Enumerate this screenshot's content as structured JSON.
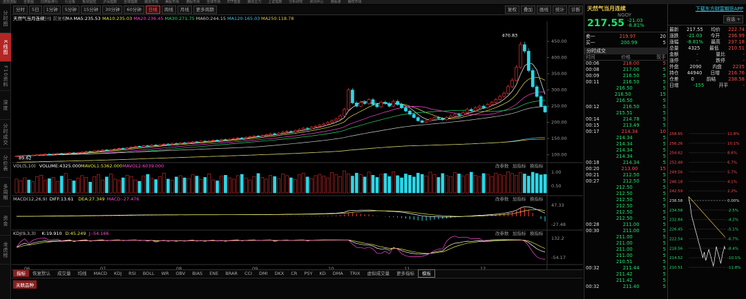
{
  "top_menu": [
    "选自选股",
    "全景图",
    "同类股排行",
    "行业板",
    "板块监控",
    "沪深指数",
    "全球指数",
    "期货市场",
    "美股市场",
    "港股市场",
    "全球市场",
    "ETF基金",
    "期货主力",
    "上证指数",
    "分析研究",
    "资讯中心",
    "港股通",
    "期权市场"
  ],
  "left_nav": [
    {
      "label": "分时图",
      "active": false
    },
    {
      "label": "K线图",
      "active": true
    },
    {
      "label": "F10资料",
      "active": false
    },
    {
      "label": "深度",
      "active": false
    },
    {
      "label": "分时成交",
      "active": false
    },
    {
      "label": "分价表",
      "active": false
    },
    {
      "label": "多周期",
      "active": false
    },
    {
      "label": "资金",
      "active": false
    },
    {
      "label": "龙虎榜",
      "active": false
    }
  ],
  "toolbar": {
    "periods": [
      "分时",
      "5日",
      "1分钟",
      "5分钟",
      "15分钟",
      "30分钟",
      "60分钟",
      "日线",
      "周线",
      "月线",
      "更多周期"
    ],
    "active_period": "日线",
    "right_buttons": [
      "复权",
      "叠加",
      "画线",
      "统计",
      "诊断"
    ]
  },
  "chart": {
    "title": "天然气当月连续",
    "subtitle": "(日线 前复权)",
    "ma_legend": [
      {
        "t": "MA",
        "c": "#cccccc"
      },
      {
        "t": "MA5:235.53",
        "c": "#ffffff"
      },
      {
        "t": "MA10:235.03",
        "c": "#e8e84a"
      },
      {
        "t": "MA20:236.45",
        "c": "#ff4ad8"
      },
      {
        "t": "MA30:271.75",
        "c": "#22e06a"
      },
      {
        "t": "MA60:244.15",
        "c": "#cccccc"
      },
      {
        "t": "MA120:165.03",
        "c": "#3ec8e8"
      },
      {
        "t": "MA250:118.78",
        "c": "#e8c84a"
      }
    ],
    "price_ticks": [
      "450.00",
      "400.00",
      "350.00",
      "300.00",
      "250.00",
      "200.00",
      "150.00",
      "100.00"
    ],
    "high_label": "470.83",
    "low_label": "89.62",
    "x_ticks": [
      "06",
      "07",
      "08",
      "09",
      "10",
      "11",
      "12"
    ],
    "chart_data": {
      "type": "candlestick",
      "ylim": [
        80,
        480
      ],
      "high": 470.83,
      "low": 89.62,
      "close": [
        96,
        97,
        98,
        97,
        99,
        100,
        101,
        102,
        101,
        103,
        104,
        103,
        105,
        106,
        105,
        107,
        108,
        110,
        109,
        112,
        113,
        115,
        114,
        116,
        118,
        120,
        119,
        122,
        124,
        126,
        125,
        128,
        127,
        130,
        128,
        131,
        133,
        132,
        135,
        134,
        137,
        136,
        138,
        140,
        139,
        142,
        141,
        143,
        145,
        144,
        147,
        146,
        148,
        150,
        152,
        151,
        154,
        156,
        158,
        157,
        160,
        162,
        165,
        163,
        167,
        170,
        172,
        171,
        175,
        178,
        182,
        180,
        185,
        188,
        192,
        195,
        200,
        205,
        210,
        220,
        240,
        300,
        260,
        250,
        262,
        258,
        270,
        255,
        248,
        262,
        258,
        250,
        265,
        255,
        245,
        235,
        225,
        215,
        205,
        200,
        205,
        210,
        215,
        212,
        208,
        215,
        220,
        225,
        222,
        230,
        240,
        236,
        245,
        250,
        245,
        255,
        262,
        270,
        280,
        290,
        310,
        330,
        370,
        440,
        420,
        360,
        310,
        280,
        250,
        232
      ],
      "volume": [
        3.2,
        2.8,
        3.5,
        3.0,
        2.6,
        3.8,
        4.1,
        2.9,
        3.3,
        3.6,
        2.7,
        3.9,
        4.5,
        3.1,
        2.8,
        3.4,
        4.0,
        3.6,
        2.5,
        3.8,
        4.2,
        3.0,
        3.7,
        4.4,
        3.2,
        2.9,
        3.5,
        4.1,
        3.8,
        3.0,
        2.7,
        3.9,
        4.3,
        3.4,
        3.1,
        3.8,
        4.6,
        3.2,
        2.9,
        3.7,
        4.0,
        3.5,
        3.3,
        4.2,
        3.9,
        3.1,
        3.6,
        4.4,
        3.0,
        2.8,
        3.9,
        4.1,
        3.5,
        3.2,
        4.0,
        4.3,
        3.4,
        3.0,
        3.8,
        4.5,
        3.6,
        3.2,
        4.1,
        3.8,
        3.3,
        4.4,
        4.0,
        3.5,
        3.1,
        4.2,
        4.6,
        3.7,
        3.3,
        4.0,
        4.3,
        3.9,
        3.5,
        4.7,
        4.2,
        3.8,
        5.1,
        4.4,
        3.9,
        4.6,
        4.2,
        3.7,
        4.8,
        4.1,
        3.6,
        4.3,
        4.5,
        3.8,
        4.9,
        4.0,
        3.5,
        4.4,
        4.1,
        3.7,
        4.6,
        4.3,
        3.9,
        4.8,
        4.2,
        3.6,
        4.5,
        4.0,
        3.8,
        4.7,
        4.4,
        3.9,
        4.2,
        4.8,
        4.1,
        3.7,
        4.5,
        4.3,
        3.8,
        4.6,
        4.2,
        4.0,
        4.9,
        4.5,
        4.1,
        4.7,
        4.4,
        3.9,
        4.8,
        4.5,
        4.2,
        4.3
      ]
    }
  },
  "vol_legend": [
    {
      "t": "VOL(5,10)",
      "c": "#cccccc"
    },
    {
      "t": "VOLUME:4325.000",
      "c": "#ffffff"
    },
    {
      "t": "MAVOL1:5362.000",
      "c": "#e8e84a"
    },
    {
      "t": "MAVOL2:6039.000",
      "c": "#ff4ad8"
    }
  ],
  "vol_ticks": [
    "1.00",
    "0.50"
  ],
  "macd_legend": [
    {
      "t": "MACD(12,26,9)",
      "c": "#cccccc"
    },
    {
      "t": "DIFF:13.61",
      "c": "#ffffff"
    },
    {
      "t": "DEA:27.349",
      "c": "#e8e84a"
    },
    {
      "t": "MACD:-27.476",
      "c": "#ff4ad8"
    }
  ],
  "macd_ticks": [
    "47.33",
    "-27.48"
  ],
  "kdj_legend": [
    {
      "t": "KDJ(9,3,3)",
      "c": "#cccccc"
    },
    {
      "t": "K:19.910",
      "c": "#ffffff"
    },
    {
      "t": "D:45.249",
      "c": "#e8e84a"
    },
    {
      "t": "J:-54.166",
      "c": "#ff4ad8"
    }
  ],
  "kdj_ticks": [
    "132.2",
    "-54.17"
  ],
  "panel_tools": [
    "改参数",
    "加指标",
    "换指标"
  ],
  "indicator_tabs": [
    "指标",
    "恢复默认",
    "成交量",
    "均线",
    "MACD",
    "KDJ",
    "RSI",
    "BOLL",
    "WR",
    "OBV",
    "BIAS",
    "ENE",
    "BRAR",
    "CCI",
    "DMI",
    "DKX",
    "CR",
    "PSY",
    "KD",
    "DMA",
    "TRIX",
    "虚拟成交量",
    "更多指标",
    "模板"
  ],
  "active_tab": "指标",
  "selected_tab": "模板",
  "bottom_tag": "关联品种",
  "quote": {
    "name": "天然气当月连续",
    "code": "NGOY",
    "price": "217.55",
    "change": "-21.03",
    "change_pct": "-8.81%",
    "bid": {
      "label": "卖一",
      "price": "219.97",
      "vol": "20"
    },
    "ask": {
      "label": "买一",
      "price": "200.99",
      "vol": "5"
    },
    "trades_title": "分时成交",
    "trades_cols": [
      "时间",
      "价格",
      "现手"
    ]
  },
  "trades": [
    [
      "00:06",
      "218.00",
      "5",
      "r"
    ],
    [
      "00:08",
      "217.00",
      "5",
      "g"
    ],
    [
      "00:09",
      "216.50",
      "5",
      "g"
    ],
    [
      "00:11",
      "216.50",
      "5",
      "g"
    ],
    [
      "",
      "216.50",
      "5",
      "g"
    ],
    [
      "",
      "216.50",
      "15",
      "g"
    ],
    [
      "",
      "216.50",
      "5",
      "g"
    ],
    [
      "00:12",
      "216.50",
      "5",
      "g"
    ],
    [
      "",
      "215.51",
      "5",
      "g"
    ],
    [
      "00:14",
      "214.78",
      "5",
      "g"
    ],
    [
      "00:15",
      "213.49",
      "5",
      "g"
    ],
    [
      "00:17",
      "214.34",
      "10",
      "r"
    ],
    [
      "",
      "214.34",
      "5",
      "g"
    ],
    [
      "",
      "214.34",
      "5",
      "g"
    ],
    [
      "",
      "214.34",
      "5",
      "g"
    ],
    [
      "",
      "214.34",
      "5",
      "g"
    ],
    [
      "00:18",
      "214.34",
      "5",
      "g"
    ],
    [
      "00:20",
      "213.00",
      "15",
      "r"
    ],
    [
      "00:21",
      "212.50",
      "5",
      "g"
    ],
    [
      "00:27",
      "212.50",
      "5",
      "g"
    ],
    [
      "",
      "212.50",
      "5",
      "g"
    ],
    [
      "",
      "212.50",
      "5",
      "g"
    ],
    [
      "",
      "212.50",
      "5",
      "g"
    ],
    [
      "",
      "212.50",
      "5",
      "g"
    ],
    [
      "",
      "212.50",
      "5",
      "g"
    ],
    [
      "",
      "212.50",
      "5",
      "g"
    ],
    [
      "00:28",
      "211.00",
      "5",
      "g"
    ],
    [
      "00:30",
      "211.00",
      "5",
      "g"
    ],
    [
      "",
      "211.00",
      "5",
      "g"
    ],
    [
      "",
      "211.00",
      "5",
      "g"
    ],
    [
      "",
      "211.00",
      "5",
      "g"
    ],
    [
      "",
      "211.00",
      "5",
      "g"
    ],
    [
      "",
      "210.51",
      "5",
      "g"
    ],
    [
      "00:32",
      "211.44",
      "5",
      "g"
    ],
    [
      "",
      "211.42",
      "5",
      "g"
    ],
    [
      "",
      "211.42",
      "5",
      "g"
    ],
    [
      "00:32",
      "211.40",
      "5",
      "g"
    ]
  ],
  "far": {
    "app": "下载东方财富期货APP",
    "self_btn": "自选",
    "stats": [
      [
        "最新",
        "217.55",
        "均价",
        "222.74"
      ],
      [
        "涨跌",
        "-21.03",
        "今开",
        "236.99"
      ],
      [
        "涨幅",
        "-8.81%",
        "最高",
        "237.18"
      ],
      [
        "总量",
        "4325",
        "最低",
        "210.51"
      ],
      [
        "金额",
        "-",
        "量比",
        "-"
      ],
      [
        "涨停",
        "-",
        "跌停",
        "-"
      ],
      [
        "外盘",
        "2090",
        "内盘",
        "2235"
      ],
      [
        "持仓",
        "44940",
        "日增",
        "216.76"
      ],
      [
        "仓差",
        "0",
        "前结",
        "238.58"
      ],
      [
        "日增",
        "-155",
        "开平",
        "-"
      ]
    ],
    "mini_left": [
      "258.65",
      "256.26",
      "254.62",
      "252.48",
      "249.56",
      "246.18",
      "242.59",
      "238.58",
      "234.58",
      "232.84",
      "226.45",
      "222.54",
      "218.56",
      "214.52",
      "210.51"
    ],
    "mini_right": [
      "11.8%",
      "10.1%",
      "8.6%",
      "6.7%",
      "5.7%",
      "4.1%",
      "2.2%",
      "0.00%",
      "-2.5%",
      "-4.2%",
      "-5.1%",
      "-6.7%",
      "-8.4%",
      "-10.1%",
      "-11.8%"
    ]
  }
}
